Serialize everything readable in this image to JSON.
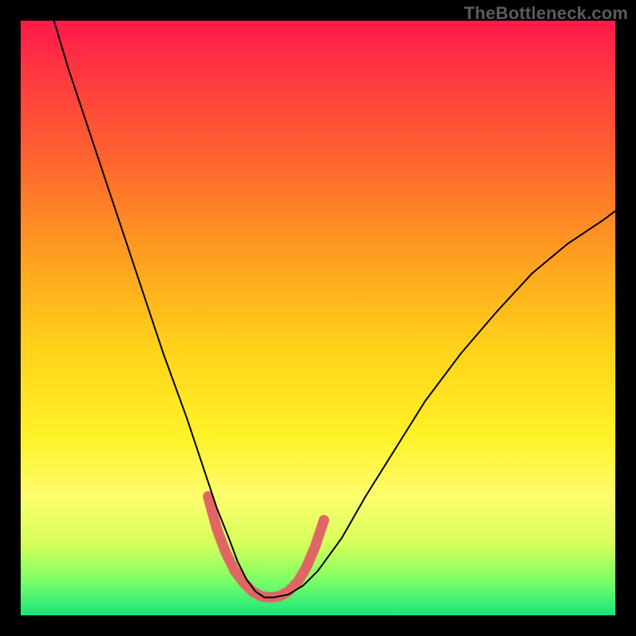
{
  "watermark": "TheBottleneck.com",
  "chart_data": {
    "type": "line",
    "title": "",
    "xlabel": "",
    "ylabel": "",
    "xlim": [
      0,
      100
    ],
    "ylim": [
      0,
      100
    ],
    "grid": false,
    "series": [
      {
        "name": "curve",
        "x": [
          5,
          8,
          12,
          16,
          20,
          24,
          28,
          31,
          33,
          35,
          36.5,
          38,
          39.5,
          41,
          42.5,
          45,
          47.5,
          50,
          54,
          58,
          63,
          68,
          74,
          80,
          86,
          92,
          98,
          100
        ],
        "y": [
          102,
          92,
          80,
          68,
          56,
          44,
          33,
          24,
          18,
          13,
          9,
          6,
          4,
          3,
          3,
          3.5,
          5,
          7.5,
          13,
          20,
          28,
          36,
          44,
          51,
          57.5,
          62.5,
          66.5,
          68
        ]
      }
    ],
    "highlight_band": {
      "description": "thick light-red overlay near curve minimum",
      "x": [
        31.5,
        33,
        34.5,
        36,
        37.5,
        39,
        40.5,
        42,
        43.5,
        45,
        46.5,
        48,
        49.5,
        51
      ],
      "y": [
        20,
        14.5,
        10.5,
        7.5,
        5.5,
        4,
        3.2,
        3,
        3.2,
        4,
        5.5,
        8,
        11.5,
        16
      ]
    },
    "background": "vertical rainbow gradient red→orange→yellow→green"
  }
}
